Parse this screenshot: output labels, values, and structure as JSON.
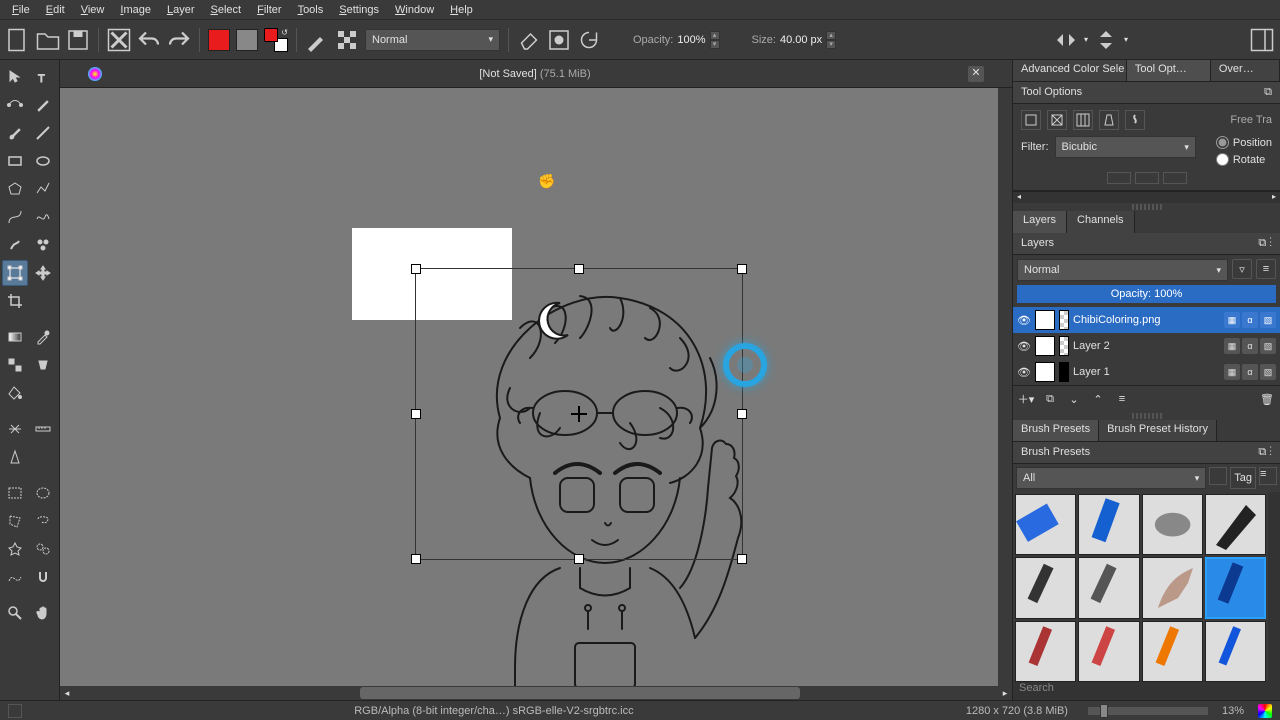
{
  "menu": [
    "File",
    "Edit",
    "View",
    "Image",
    "Layer",
    "Select",
    "Filter",
    "Tools",
    "Settings",
    "Window",
    "Help"
  ],
  "toolbar": {
    "blend_mode": "Normal",
    "opacity_label": "Opacity:",
    "opacity_value": "100%",
    "size_label": "Size:",
    "size_value": "40.00 px"
  },
  "document": {
    "saved_state": "[Not Saved]",
    "memory": "(75.1 MiB)"
  },
  "right_tabs": [
    "Advanced Color Sele…",
    "Tool Opt…",
    "Over…"
  ],
  "tool_options": {
    "title": "Tool Options",
    "free_transform": "Free Tra",
    "filter_label": "Filter:",
    "filter_value": "Bicubic",
    "position": "Position",
    "rotate": "Rotate"
  },
  "layers_panel": {
    "tab_layers": "Layers",
    "tab_channels": "Channels",
    "title": "Layers",
    "blend_mode": "Normal",
    "opacity_text": "Opacity: 100%",
    "layers": [
      {
        "name": "ChibiColoring.png",
        "selected": true
      },
      {
        "name": "Layer 2",
        "selected": false
      },
      {
        "name": "Layer 1",
        "selected": false
      }
    ]
  },
  "brush_panel": {
    "tab_presets": "Brush Presets",
    "tab_history": "Brush Preset History",
    "title": "Brush Presets",
    "filter": "All",
    "tag": "Tag",
    "search_placeholder": "Search"
  },
  "status": {
    "color_info": "RGB/Alpha (8-bit integer/cha…)  sRGB-elle-V2-srgbtrc.icc",
    "canvas_size": "1280 x 720 (3.8 MiB)",
    "zoom": "13%"
  }
}
